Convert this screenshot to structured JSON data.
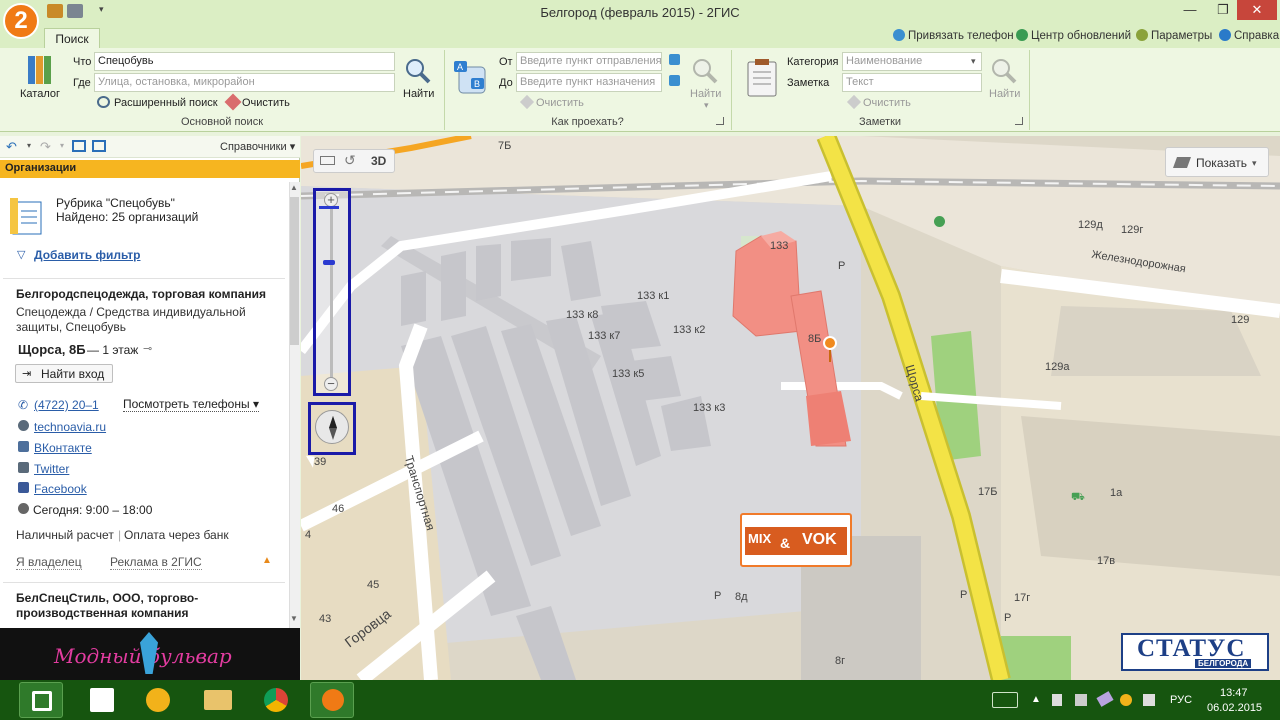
{
  "window": {
    "title": "Белгород (февраль 2015) - 2ГИС",
    "logo": "2"
  },
  "window_controls": {
    "minimize": "—",
    "maximize": "❐",
    "close": "✕"
  },
  "ribbon": {
    "tab": "Поиск",
    "top_links": {
      "phone": "Привязать телефон",
      "updates": "Центр обновлений",
      "settings": "Параметры",
      "help": "Справка"
    },
    "search": {
      "catalog": "Каталог",
      "what_label": "Что",
      "what_value": "Спецобувь",
      "where_label": "Где",
      "where_placeholder": "Улица, остановка, микрорайон",
      "find": "Найти",
      "advanced": "Расширенный поиск",
      "clear": "Очистить",
      "group": "Основной поиск"
    },
    "route": {
      "from_label": "От",
      "from_placeholder": "Введите пункт отправления",
      "to_label": "До",
      "to_placeholder": "Введите пункт назначения",
      "clear": "Очистить",
      "find": "Найти",
      "group": "Как проехать?"
    },
    "notes": {
      "category_label": "Категория",
      "category_placeholder": "Наименование",
      "note_label": "Заметка",
      "note_placeholder": "Текст",
      "clear": "Очистить",
      "find": "Найти",
      "group": "Заметки"
    }
  },
  "left_panel": {
    "directories": "Справочники",
    "section": "Организации",
    "rubric_title": "Рубрика \"Спецобувь\"",
    "found": "Найдено: 25 организаций",
    "add_filter": "Добавить фильтр",
    "org1": {
      "name": "Белгородспецодежда, торговая компания",
      "desc": "Спецодежда / Средства индивидуальной защиты, Спецобувь",
      "address": "Щорса, 8Б",
      "floor": "— 1 этаж",
      "find_entrance": "Найти вход",
      "phone": "(4722) 20–1",
      "show_phones": "Посмотреть телефоны",
      "site": "technoavia.ru",
      "vk": "ВКонтакте",
      "twitter": "Twitter",
      "facebook": "Facebook",
      "hours": "Сегодня: 9:00 – 18:00",
      "payment_cash": "Наличный расчет",
      "payment_bank": "Оплата через банк",
      "owner": "Я владелец",
      "ad": "Реклама в 2ГИС"
    },
    "org2": {
      "name": "БелСпецСтиль, ООО, торгово-производственная компания"
    },
    "banner": "Модный бульвар"
  },
  "map": {
    "view_3d": "3D",
    "show_btn": "Показать",
    "labels": {
      "b7b": "7Б",
      "b133": "133",
      "b133k1": "133 к1",
      "b133k8": "133 к8",
      "b133k7": "133 к7",
      "b133k2": "133 к2",
      "b133k5": "133 к5",
      "b133k3": "133 к3",
      "b8b": "8Б",
      "b129d": "129д",
      "b129g": "129г",
      "b129": "129",
      "b129a": "129а",
      "b17b": "17Б",
      "b1a": "1а",
      "b17v": "17в",
      "b17g": "17г",
      "b8d": "8д",
      "b8g": "8г",
      "b46": "46",
      "b45": "45",
      "b43": "43",
      "b39": "39",
      "b4": "4",
      "p1": "P",
      "p2": "P",
      "p3": "P",
      "p4": "P",
      "street_shorsa": "Щорса",
      "street_transport": "Транспортная",
      "street_gorovtsa": "Горовца",
      "street_rail": "Железнодорожная"
    },
    "mix": "MIX",
    "vok": "VOK",
    "amp": "&",
    "status_logo": "СТАТУС",
    "status_city": "БЕЛГОРОДА"
  },
  "taskbar": {
    "lang": "РУС",
    "time": "13:47",
    "date": "06.02.2015"
  }
}
